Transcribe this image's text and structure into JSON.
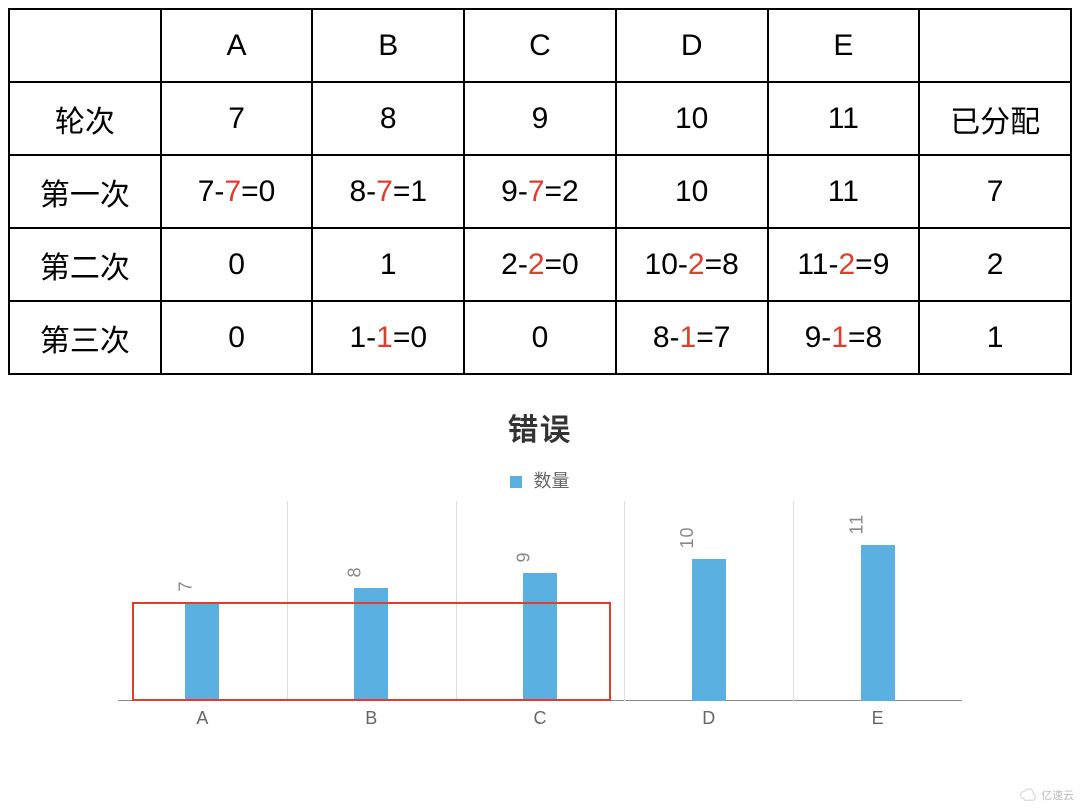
{
  "table": {
    "header": [
      "",
      "A",
      "B",
      "C",
      "D",
      "E",
      ""
    ],
    "rows": [
      {
        "label": "轮次",
        "cells": [
          {
            "parts": [
              {
                "t": "7"
              }
            ]
          },
          {
            "parts": [
              {
                "t": "8"
              }
            ]
          },
          {
            "parts": [
              {
                "t": "9"
              }
            ]
          },
          {
            "parts": [
              {
                "t": "10"
              }
            ]
          },
          {
            "parts": [
              {
                "t": "11"
              }
            ]
          }
        ],
        "tail": "已分配"
      },
      {
        "label": "第一次",
        "cells": [
          {
            "parts": [
              {
                "t": "7-"
              },
              {
                "t": "7",
                "hl": true
              },
              {
                "t": "=0"
              }
            ]
          },
          {
            "parts": [
              {
                "t": "8-"
              },
              {
                "t": "7",
                "hl": true
              },
              {
                "t": "=1"
              }
            ]
          },
          {
            "parts": [
              {
                "t": "9-"
              },
              {
                "t": "7",
                "hl": true
              },
              {
                "t": "=2"
              }
            ]
          },
          {
            "parts": [
              {
                "t": "10"
              }
            ]
          },
          {
            "parts": [
              {
                "t": "11"
              }
            ]
          }
        ],
        "tail": "7"
      },
      {
        "label": "第二次",
        "cells": [
          {
            "parts": [
              {
                "t": "0"
              }
            ]
          },
          {
            "parts": [
              {
                "t": "1"
              }
            ]
          },
          {
            "parts": [
              {
                "t": "2-"
              },
              {
                "t": "2",
                "hl": true
              },
              {
                "t": "=0"
              }
            ]
          },
          {
            "parts": [
              {
                "t": "10-"
              },
              {
                "t": "2",
                "hl": true
              },
              {
                "t": "=8"
              }
            ]
          },
          {
            "parts": [
              {
                "t": "11-"
              },
              {
                "t": "2",
                "hl": true
              },
              {
                "t": "=9"
              }
            ]
          }
        ],
        "tail": "2"
      },
      {
        "label": "第三次",
        "cells": [
          {
            "parts": [
              {
                "t": "0"
              }
            ]
          },
          {
            "parts": [
              {
                "t": "1-"
              },
              {
                "t": "1",
                "hl": true
              },
              {
                "t": "=0"
              }
            ]
          },
          {
            "parts": [
              {
                "t": "0"
              }
            ]
          },
          {
            "parts": [
              {
                "t": "8-"
              },
              {
                "t": "1",
                "hl": true
              },
              {
                "t": "=7"
              }
            ]
          },
          {
            "parts": [
              {
                "t": "9-"
              },
              {
                "t": "1",
                "hl": true
              },
              {
                "t": "=8"
              }
            ]
          }
        ],
        "tail": "1"
      }
    ]
  },
  "chart_data": {
    "type": "bar",
    "title": "错误",
    "legend": "数量",
    "categories": [
      "A",
      "B",
      "C",
      "D",
      "E"
    ],
    "values": [
      7,
      8,
      9,
      10,
      11
    ],
    "ylim": [
      0,
      11
    ],
    "highlight_box_range": {
      "start": "A",
      "end": "C",
      "top_value": 7
    }
  },
  "watermark": "亿速云"
}
